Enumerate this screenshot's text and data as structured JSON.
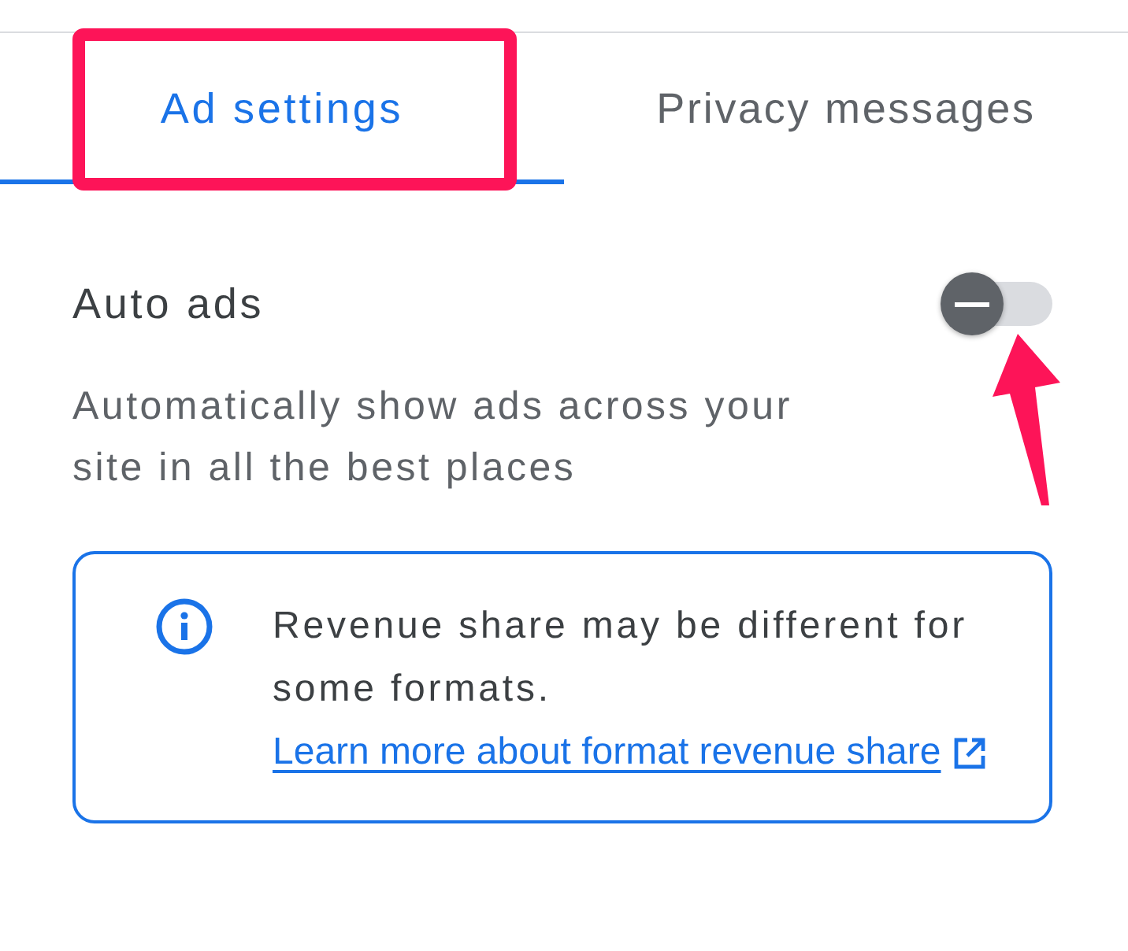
{
  "tabs": [
    {
      "label": "Ad settings",
      "selected": true
    },
    {
      "label": "Privacy messages",
      "selected": false
    }
  ],
  "auto_ads": {
    "title": "Auto ads",
    "toggle": {
      "on": false
    },
    "description": "Automatically show ads across your site in all the best places"
  },
  "info_box": {
    "text": "Revenue share may be different for some formats.",
    "link": "Learn more about format revenue share"
  }
}
